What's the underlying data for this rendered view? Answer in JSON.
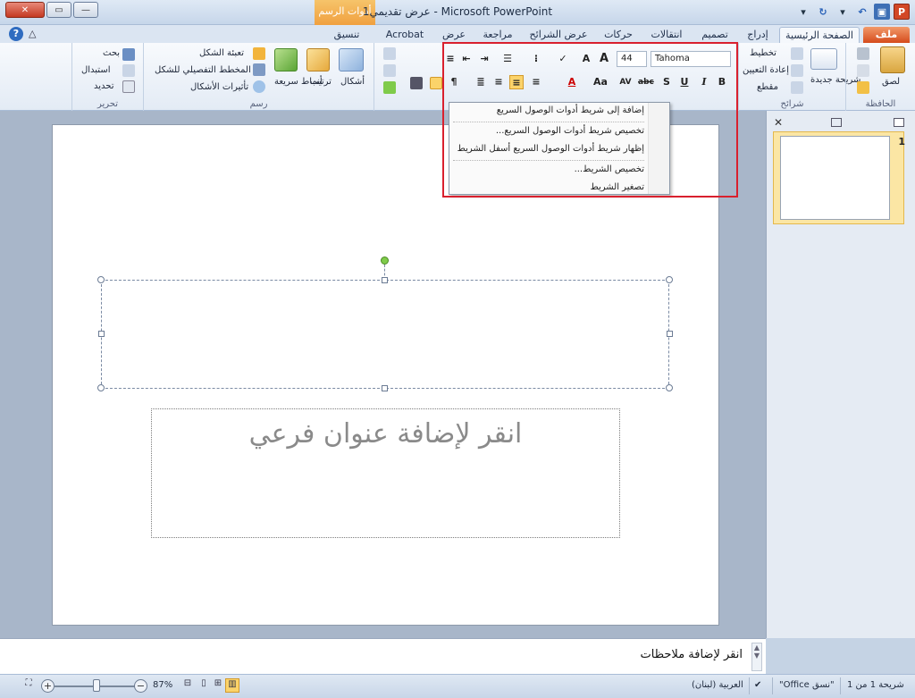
{
  "window": {
    "title": "عرض تقديمي1 - Microsoft PowerPoint",
    "context_tab_group": "أدوات الرسم"
  },
  "tabs": [
    {
      "label": "ملف"
    },
    {
      "label": "الصفحة الرئيسية"
    },
    {
      "label": "إدراج"
    },
    {
      "label": "تصميم"
    },
    {
      "label": "انتقالات"
    },
    {
      "label": "حركات"
    },
    {
      "label": "عرض الشرائح"
    },
    {
      "label": "مراجعة"
    },
    {
      "label": "عرض"
    },
    {
      "label": "Acrobat"
    },
    {
      "label": "تنسيق"
    }
  ],
  "ribbon": {
    "clipboard": {
      "group": "الحافظة",
      "paste": "لصق"
    },
    "slides": {
      "group": "شرائح",
      "new_slide": "شريحة جديدة",
      "layout": "تخطيط",
      "reset": "إعادة التعيين",
      "section": "مقطع"
    },
    "font": {
      "name": "Tahoma",
      "size": "44"
    },
    "drawing": {
      "group": "رسم",
      "shapes": "أشكال",
      "arrange": "ترتيب",
      "quick_styles": "أنماط سريعة",
      "fill": "تعبئة الشكل",
      "outline": "المخطط التفصيلي للشكل",
      "effects": "تأثيرات الأشكال"
    },
    "editing": {
      "group": "تحرير",
      "find": "بحث",
      "replace": "استبدال",
      "select": "تحديد"
    }
  },
  "context_menu": {
    "items": [
      "إضافة إلى شريط أدوات الوصول السريع",
      "تخصيص شريط أدوات الوصول السريع...",
      "إظهار شريط أدوات الوصول السريع أسفل الشريط",
      "تخصيص الشريط...",
      "تصغير الشريط"
    ]
  },
  "slide": {
    "subtitle_placeholder": "انقر لإضافة عنوان فرعي"
  },
  "thumbnails": {
    "slide_number": "1"
  },
  "notes": {
    "placeholder": "انقر لإضافة ملاحظات"
  },
  "status": {
    "slide_info": "شريحة 1 من 1",
    "theme": "\"نسق Office\"",
    "language": "العربية (لبنان)",
    "zoom": "87%"
  },
  "colors": {
    "highlight": "#d9202e",
    "file_tab": "#d54b1c",
    "context_tab": "#f0a040",
    "rotate_handle": "#7fcb4a"
  }
}
